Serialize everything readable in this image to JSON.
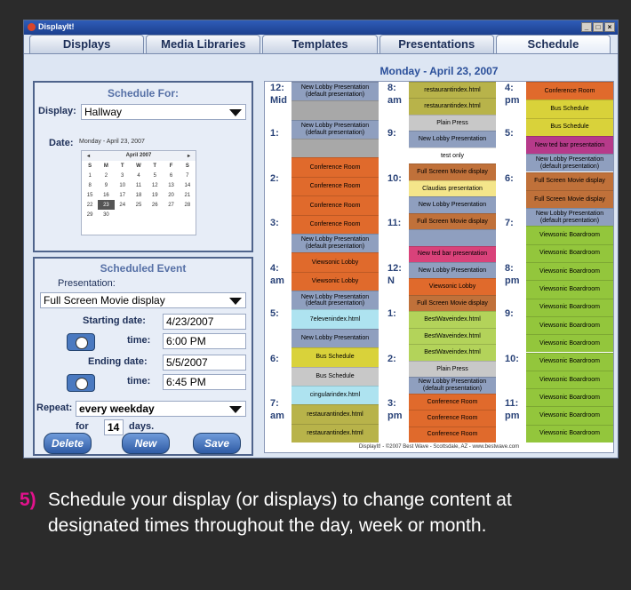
{
  "window": {
    "title": "DisplayIt!"
  },
  "tabs": [
    "Displays",
    "Media Libraries",
    "Templates",
    "Presentations",
    "Schedule"
  ],
  "schedule_for": {
    "heading": "Schedule For:",
    "display_label": "Display:",
    "display_value": "Hallway",
    "date_label": "Date:",
    "date_value": "Monday - April 23, 2007",
    "calendar": {
      "month": "April 2007",
      "prev": "◂",
      "next": "▸",
      "weekdays": [
        "S",
        "M",
        "T",
        "W",
        "T",
        "F",
        "S"
      ],
      "weeks": [
        [
          "1",
          "2",
          "3",
          "4",
          "5",
          "6",
          "7"
        ],
        [
          "8",
          "9",
          "10",
          "11",
          "12",
          "13",
          "14"
        ],
        [
          "15",
          "16",
          "17",
          "18",
          "19",
          "20",
          "21"
        ],
        [
          "22",
          "23",
          "24",
          "25",
          "26",
          "27",
          "28"
        ],
        [
          "29",
          "30",
          "",
          "",
          "",
          "",
          ""
        ]
      ],
      "selected": "23"
    }
  },
  "scheduled_event": {
    "heading": "Scheduled Event",
    "presentation_label": "Presentation:",
    "presentation_value": "Full Screen Movie display",
    "start_date_label": "Starting date:",
    "start_date": "4/23/2007",
    "start_time_label": "time:",
    "start_time": "6:00 PM",
    "end_date_label": "Ending date:",
    "end_date": "5/5/2007",
    "end_time_label": "time:",
    "end_time": "6:45 PM",
    "repeat_label": "Repeat:",
    "repeat_value": "every weekday",
    "for_label": "for",
    "for_value": "14",
    "days_label": "days.",
    "buttons": {
      "delete": "Delete",
      "new": "New",
      "save": "Save"
    }
  },
  "schedule": {
    "title": "Monday - April 23, 2007",
    "footer": "DisplayIt! - ©2007 Best Wave - Scottsdale, AZ - www.bestwave.com",
    "columns": [
      {
        "times": [
          [
            "12:",
            "Mid"
          ],
          [
            "1:",
            ""
          ],
          [
            "2:",
            ""
          ],
          [
            "3:",
            ""
          ],
          [
            "4:",
            "am"
          ],
          [
            "5:",
            ""
          ],
          [
            "6:",
            ""
          ],
          [
            "7:",
            "am"
          ]
        ],
        "events": [
          {
            "label": "New Lobby Presentation (default presentation)",
            "color": "#8f9fbf"
          },
          {
            "label": "",
            "color": "#a8a8a8"
          },
          {
            "label": "New Lobby Presentation (default presentation)",
            "color": "#8f9fbf"
          },
          {
            "label": "",
            "color": "#a8a8a8"
          },
          {
            "label": "Conference Room",
            "color": "#e06a2c"
          },
          {
            "label": "Conference Room",
            "color": "#e06a2c"
          },
          {
            "label": "Conference Room",
            "color": "#e06a2c"
          },
          {
            "label": "Conference Room",
            "color": "#e06a2c"
          },
          {
            "label": "New Lobby Presentation (default presentation)",
            "color": "#8f9fbf"
          },
          {
            "label": "Viewsonic Lobby",
            "color": "#e06a2c"
          },
          {
            "label": "Viewsonic Lobby",
            "color": "#e06a2c"
          },
          {
            "label": "New Lobby Presentation (default presentation)",
            "color": "#8f9fbf"
          },
          {
            "label": "7elevenindex.html",
            "color": "#aee3f0"
          },
          {
            "label": "New Lobby Presentation",
            "color": "#8f9fbf"
          },
          {
            "label": "Bus Schedule",
            "color": "#d9d23a"
          },
          {
            "label": "Bus Schedule",
            "color": "#c8c8c8"
          },
          {
            "label": "cingularindex.html",
            "color": "#aee3f0"
          },
          {
            "label": "restaurantindex.html",
            "color": "#b8b34a"
          },
          {
            "label": "restaurantindex.html",
            "color": "#b8b34a"
          }
        ]
      },
      {
        "times": [
          [
            "8:",
            "am"
          ],
          [
            "9:",
            ""
          ],
          [
            "10:",
            ""
          ],
          [
            "11:",
            ""
          ],
          [
            "12:",
            "N"
          ],
          [
            "1:",
            ""
          ],
          [
            "2:",
            ""
          ],
          [
            "3:",
            "pm"
          ]
        ],
        "events": [
          {
            "label": "restaurantindex.html",
            "color": "#b8b34a"
          },
          {
            "label": "restaurantindex.html",
            "color": "#b8b34a"
          },
          {
            "label": "Plain Press",
            "color": "#c8c8c8"
          },
          {
            "label": "New Lobby Presentation",
            "color": "#8f9fbf"
          },
          {
            "label": "test only",
            "color": "#ffffff"
          },
          {
            "label": "Full Screen Movie display",
            "color": "#c0713a"
          },
          {
            "label": "Claudias presentation",
            "color": "#f4e58a"
          },
          {
            "label": "New Lobby Presentation",
            "color": "#8f9fbf"
          },
          {
            "label": "Full Screen Movie display",
            "color": "#c0713a"
          },
          {
            "label": "",
            "color": "#8f9fbf"
          },
          {
            "label": "New ted bar presentation",
            "color": "#d9427a"
          },
          {
            "label": "New Lobby Presentation",
            "color": "#8f9fbf"
          },
          {
            "label": "Viewsonic Lobby",
            "color": "#e06a2c"
          },
          {
            "label": "Full Screen Movie display",
            "color": "#c0713a"
          },
          {
            "label": "BestWaveindex.html",
            "color": "#b3d35a"
          },
          {
            "label": "BestWaveindex.html",
            "color": "#b3d35a"
          },
          {
            "label": "BestWaveindex.html",
            "color": "#b3d35a"
          },
          {
            "label": "Plain Press",
            "color": "#c8c8c8"
          },
          {
            "label": "New Lobby Presentation (default presentation)",
            "color": "#8f9fbf"
          },
          {
            "label": "Conference Room",
            "color": "#e06a2c"
          },
          {
            "label": "Conference Room",
            "color": "#e06a2c"
          },
          {
            "label": "Conference Room",
            "color": "#e06a2c"
          }
        ]
      },
      {
        "times": [
          [
            "4:",
            "pm"
          ],
          [
            "5:",
            ""
          ],
          [
            "6:",
            ""
          ],
          [
            "7:",
            ""
          ],
          [
            "8:",
            "pm"
          ],
          [
            "9:",
            ""
          ],
          [
            "10:",
            ""
          ],
          [
            "11:",
            "pm"
          ]
        ],
        "events": [
          {
            "label": "Conference Room",
            "color": "#e06a2c"
          },
          {
            "label": "Bus Schedule",
            "color": "#d9d23a"
          },
          {
            "label": "Bus Schedule",
            "color": "#d9d23a"
          },
          {
            "label": "New ted bar presentation",
            "color": "#b63a8a"
          },
          {
            "label": "New Lobby Presentation (default presentation)",
            "color": "#8f9fbf"
          },
          {
            "label": "Full Screen Movie display",
            "color": "#c0713a"
          },
          {
            "label": "Full Screen Movie display",
            "color": "#c0713a"
          },
          {
            "label": "New Lobby Presentation (default presentation)",
            "color": "#8f9fbf"
          },
          {
            "label": "Viewsonic Boardroom",
            "color": "#93c63c"
          },
          {
            "label": "Viewsonic Boardroom",
            "color": "#93c63c"
          },
          {
            "label": "Viewsonic Boardroom",
            "color": "#93c63c"
          },
          {
            "label": "Viewsonic Boardroom",
            "color": "#93c63c"
          },
          {
            "label": "Viewsonic Boardroom",
            "color": "#93c63c"
          },
          {
            "label": "Viewsonic Boardroom",
            "color": "#93c63c"
          },
          {
            "label": "Viewsonic Boardroom",
            "color": "#93c63c"
          },
          {
            "label": "Viewsonic Boardroom",
            "color": "#93c63c"
          },
          {
            "label": "Viewsonic Boardroom",
            "color": "#93c63c"
          },
          {
            "label": "Viewsonic Boardroom",
            "color": "#93c63c"
          },
          {
            "label": "Viewsonic Boardroom",
            "color": "#93c63c"
          },
          {
            "label": "Viewsonic Boardroom",
            "color": "#93c63c"
          }
        ]
      }
    ]
  },
  "caption": {
    "number": "5)",
    "text": "Schedule your display (or displays) to change content at designated times throughout the day, week or month."
  }
}
